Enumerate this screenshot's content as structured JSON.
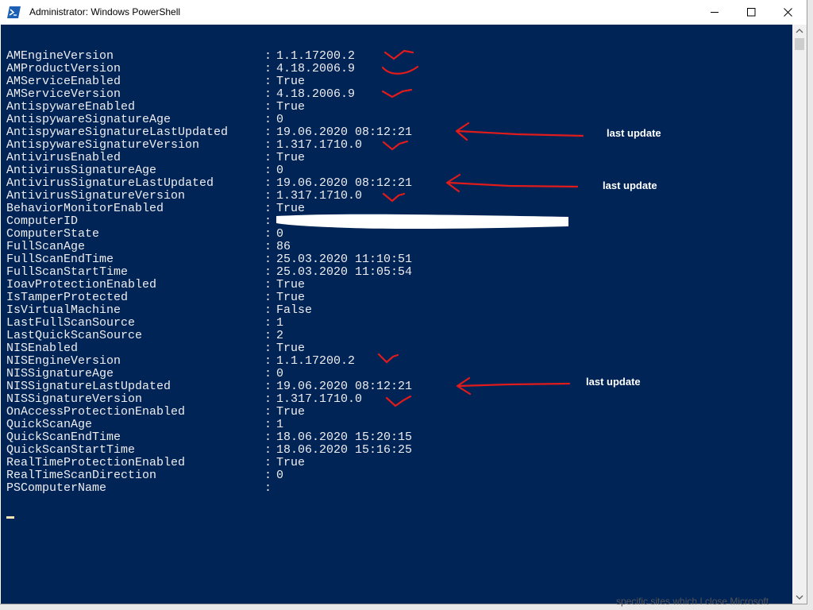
{
  "window": {
    "title": "Administrator: Windows PowerShell"
  },
  "console": {
    "colors": {
      "background": "#012456",
      "text": "#eeedf0",
      "cursor": "#efe5b6"
    },
    "rows": [
      {
        "key": "AMEngineVersion",
        "sep": ":",
        "value": "1.1.17200.2"
      },
      {
        "key": "AMProductVersion",
        "sep": ":",
        "value": "4.18.2006.9"
      },
      {
        "key": "AMServiceEnabled",
        "sep": ":",
        "value": "True"
      },
      {
        "key": "AMServiceVersion",
        "sep": ":",
        "value": "4.18.2006.9"
      },
      {
        "key": "AntispywareEnabled",
        "sep": ":",
        "value": "True"
      },
      {
        "key": "AntispywareSignatureAge",
        "sep": ":",
        "value": "0"
      },
      {
        "key": "AntispywareSignatureLastUpdated",
        "sep": ":",
        "value": "19.06.2020 08:12:21"
      },
      {
        "key": "AntispywareSignatureVersion",
        "sep": ":",
        "value": "1.317.1710.0"
      },
      {
        "key": "AntivirusEnabled",
        "sep": ":",
        "value": "True"
      },
      {
        "key": "AntivirusSignatureAge",
        "sep": ":",
        "value": "0"
      },
      {
        "key": "AntivirusSignatureLastUpdated",
        "sep": ":",
        "value": "19.06.2020 08:12:21"
      },
      {
        "key": "AntivirusSignatureVersion",
        "sep": ":",
        "value": "1.317.1710.0"
      },
      {
        "key": "BehaviorMonitorEnabled",
        "sep": ":",
        "value": "True"
      },
      {
        "key": "ComputerID",
        "sep": ":",
        "value": ""
      },
      {
        "key": "ComputerState",
        "sep": ":",
        "value": "0"
      },
      {
        "key": "FullScanAge",
        "sep": ":",
        "value": "86"
      },
      {
        "key": "FullScanEndTime",
        "sep": ":",
        "value": "25.03.2020 11:10:51"
      },
      {
        "key": "FullScanStartTime",
        "sep": ":",
        "value": "25.03.2020 11:05:54"
      },
      {
        "key": "IoavProtectionEnabled",
        "sep": ":",
        "value": "True"
      },
      {
        "key": "IsTamperProtected",
        "sep": ":",
        "value": "True"
      },
      {
        "key": "IsVirtualMachine",
        "sep": ":",
        "value": "False"
      },
      {
        "key": "LastFullScanSource",
        "sep": ":",
        "value": "1"
      },
      {
        "key": "LastQuickScanSource",
        "sep": ":",
        "value": "2"
      },
      {
        "key": "NISEnabled",
        "sep": ":",
        "value": "True"
      },
      {
        "key": "NISEngineVersion",
        "sep": ":",
        "value": "1.1.17200.2"
      },
      {
        "key": "NISSignatureAge",
        "sep": ":",
        "value": "0"
      },
      {
        "key": "NISSignatureLastUpdated",
        "sep": ":",
        "value": "19.06.2020 08:12:21"
      },
      {
        "key": "NISSignatureVersion",
        "sep": ":",
        "value": "1.317.1710.0"
      },
      {
        "key": "OnAccessProtectionEnabled",
        "sep": ":",
        "value": "True"
      },
      {
        "key": "QuickScanAge",
        "sep": ":",
        "value": "1"
      },
      {
        "key": "QuickScanEndTime",
        "sep": ":",
        "value": "18.06.2020 15:20:15"
      },
      {
        "key": "QuickScanStartTime",
        "sep": ":",
        "value": "18.06.2020 15:16:25"
      },
      {
        "key": "RealTimeProtectionEnabled",
        "sep": ":",
        "value": "True"
      },
      {
        "key": "RealTimeScanDirection",
        "sep": ":",
        "value": "0"
      },
      {
        "key": "PSComputerName",
        "sep": ":",
        "value": ""
      }
    ]
  },
  "annotations": {
    "color": "#e01b1b",
    "notes": [
      "last update",
      "last update",
      "last update"
    ]
  },
  "background_window": {
    "partial_text": "specific sites which I close Microsoft"
  }
}
